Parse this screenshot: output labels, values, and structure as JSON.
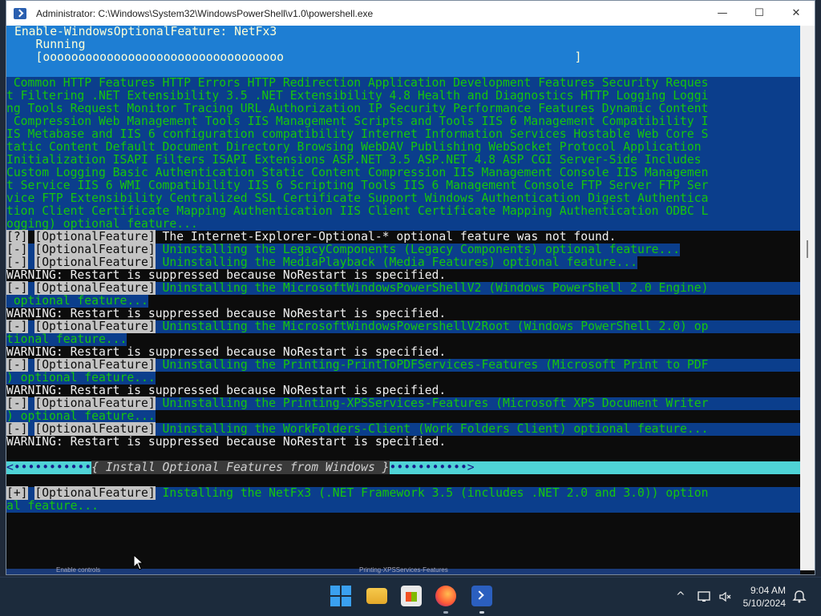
{
  "window": {
    "title": "Administrator: C:\\Windows\\System32\\WindowsPowerShell\\v1.0\\powershell.exe",
    "minimize": "—",
    "maximize": "☐",
    "close": "✕"
  },
  "progress": {
    "activity": "Enable-WindowsOptionalFeature: NetFx3",
    "status": "   Running",
    "bar": "   [oooooooooooooooooooooooooooooooooo                                         ]"
  },
  "feature_block": [
    " Common HTTP Features HTTP Errors HTTP Redirection Application Development Features Security Reques",
    "t Filtering .NET Extensibility 3.5 .NET Extensibility 4.8 Health and Diagnostics HTTP Logging Loggi",
    "ng Tools Request Monitor Tracing URL Authorization IP Security Performance Features Dynamic Content",
    " Compression Web Management Tools IIS Management Scripts and Tools IIS 6 Management Compatibility I",
    "IS Metabase and IIS 6 configuration compatibility Internet Information Services Hostable Web Core S",
    "tatic Content Default Document Directory Browsing WebDAV Publishing WebSocket Protocol Application",
    "Initialization ISAPI Filters ISAPI Extensions ASP.NET 3.5 ASP.NET 4.8 ASP CGI Server-Side Includes",
    "Custom Logging Basic Authentication Static Content Compression IIS Management Console IIS Managemen",
    "t Service IIS 6 WMI Compatibility IIS 6 Scripting Tools IIS 6 Management Console FTP Server FTP Ser",
    "vice FTP Extensibility Centralized SSL Certificate Support Windows Authentication Digest Authentica",
    "tion Client Certificate Mapping Authentication IIS Client Certificate Mapping Authentication ODBC L",
    "ogging) optional feature..."
  ],
  "tag_label": "[OptionalFeature]",
  "log": [
    {
      "marker": "[?]",
      "text": " The Internet-Explorer-Optional-* optional feature was not found.",
      "style": "white"
    },
    {
      "marker": "[-]",
      "text": " Uninstalling the LegacyComponents (Legacy Components) optional feature...",
      "style": "green"
    },
    {
      "marker": "[-]",
      "text": " Uninstalling the MediaPlayback (Media Features) optional feature...",
      "style": "green"
    }
  ],
  "warning": "WARNING: Restart is suppressed because NoRestart is specified.",
  "wrapped_log": [
    {
      "marker": "[-]",
      "line1": " Uninstalling the MicrosoftWindowsPowerShellV2 (Windows PowerShell 2.0 Engine)",
      "line2": " optional feature..."
    },
    {
      "marker": "[-]",
      "line1": " Uninstalling the MicrosoftWindowsPowershellV2Root (Windows PowerShell 2.0) op",
      "line2": "tional feature..."
    },
    {
      "marker": "[-]",
      "line1": " Uninstalling the Printing-PrintToPDFServices-Features (Microsoft Print to PDF",
      "line2": ") optional feature..."
    },
    {
      "marker": "[-]",
      "line1": " Uninstalling the Printing-XPSServices-Features (Microsoft XPS Document Writer",
      "line2": ") optional feature..."
    }
  ],
  "workfolders": {
    "marker": "[-]",
    "text": " Uninstalling the WorkFolders-Client (Work Folders Client) optional feature..."
  },
  "section": {
    "left": "<•••••••••••",
    "label": "{ Install Optional Features from Windows }",
    "right": "•••••••••••>"
  },
  "install": {
    "marker": "[+]",
    "line1": " Installing the NetFx3 (.NET Framework 3.5 (includes .NET 2.0 and 3.0)) option",
    "line2": "al feature..."
  },
  "background_hints": {
    "left": "Enable controls",
    "middle": "Printing-XPSServices-Features"
  },
  "taskbar": {
    "icons": [
      "windows-start-icon",
      "file-explorer-icon",
      "microsoft-store-icon",
      "firefox-icon",
      "powershell-icon"
    ],
    "tray_chevron": "^",
    "time": "9:04 AM",
    "date": "5/10/2024"
  },
  "colors": {
    "console_bg": "#0c0c0c",
    "progress_bg": "#1e7ed3",
    "line_bg": "#0b3e8c",
    "green_text": "#16c60c",
    "separator_bg": "#4fd3d6"
  }
}
